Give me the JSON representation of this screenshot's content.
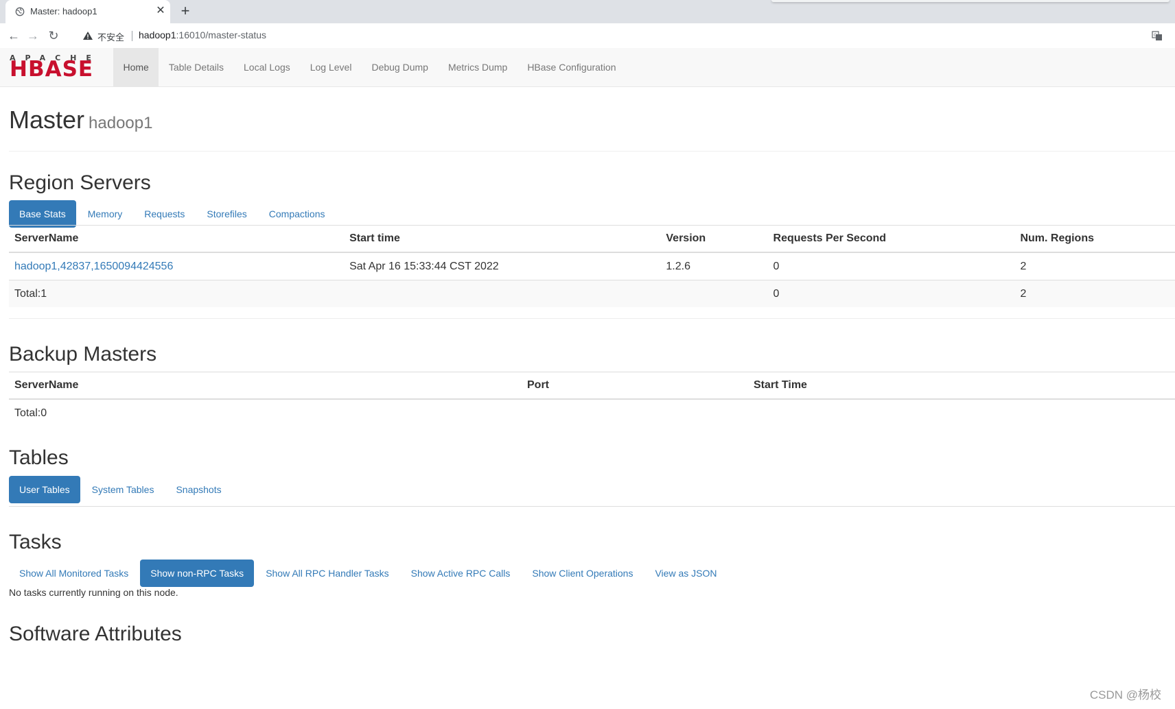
{
  "browser": {
    "tab_title": "Master: hadoop1",
    "insecure_label": "不安全",
    "url_host": "hadoop1",
    "url_path": ":16010/master-status"
  },
  "logo": {
    "apache": "APACHE",
    "hbase": "HBASE"
  },
  "nav": {
    "items": [
      "Home",
      "Table Details",
      "Local Logs",
      "Log Level",
      "Debug Dump",
      "Metrics Dump",
      "HBase Configuration"
    ],
    "active": "Home"
  },
  "header": {
    "title": "Master",
    "subtitle": "hadoop1"
  },
  "region_servers": {
    "heading": "Region Servers",
    "tabs": [
      "Base Stats",
      "Memory",
      "Requests",
      "Storefiles",
      "Compactions"
    ],
    "active_tab": "Base Stats",
    "columns": [
      "ServerName",
      "Start time",
      "Version",
      "Requests Per Second",
      "Num. Regions"
    ],
    "rows": [
      [
        "hadoop1,42837,1650094424556",
        "Sat Apr 16 15:33:44 CST 2022",
        "1.2.6",
        "0",
        "2"
      ]
    ],
    "total": [
      "Total:1",
      "",
      "",
      "0",
      "2"
    ]
  },
  "backup_masters": {
    "heading": "Backup Masters",
    "columns": [
      "ServerName",
      "Port",
      "Start Time"
    ],
    "total": "Total:0"
  },
  "tables": {
    "heading": "Tables",
    "tabs": [
      "User Tables",
      "System Tables",
      "Snapshots"
    ],
    "active_tab": "User Tables"
  },
  "tasks": {
    "heading": "Tasks",
    "tabs": [
      "Show All Monitored Tasks",
      "Show non-RPC Tasks",
      "Show All RPC Handler Tasks",
      "Show Active RPC Calls",
      "Show Client Operations",
      "View as JSON"
    ],
    "active_tab": "Show non-RPC Tasks",
    "message": "No tasks currently running on this node."
  },
  "software_attributes": {
    "heading": "Software Attributes"
  },
  "watermark": "CSDN @杨校",
  "colors": {
    "link": "#337ab7",
    "hbase_red": "#c8102e",
    "navbar_bg": "#f8f8f8"
  }
}
